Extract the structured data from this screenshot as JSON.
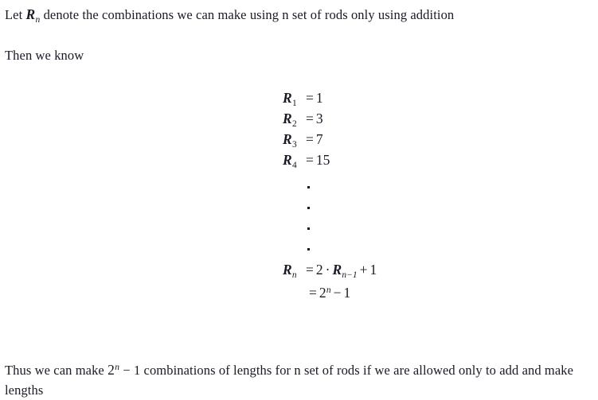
{
  "document": {
    "intro": {
      "before_var": "Let ",
      "var_base": "R",
      "var_sub": "n",
      "after_var": " denote the combinations we can make using n set of rods only using addition"
    },
    "then_line": "Then we know",
    "equations": [
      {
        "lhs_base": "R",
        "lhs_sub": "1",
        "relation": "=",
        "rhs": "1"
      },
      {
        "lhs_base": "R",
        "lhs_sub": "2",
        "relation": "=",
        "rhs": "3"
      },
      {
        "lhs_base": "R",
        "lhs_sub": "3",
        "relation": "=",
        "rhs": "7"
      },
      {
        "lhs_base": "R",
        "lhs_sub": "4",
        "relation": "=",
        "rhs": "15"
      }
    ],
    "vertical_dots_count": 4,
    "recurrence": {
      "lhs_base": "R",
      "lhs_sub": "n",
      "relation": "=",
      "rhs_coefficient": "2",
      "rhs_dot_operator": "·",
      "rhs_term_base": "R",
      "rhs_term_sub": "n−1",
      "rhs_plus": "+",
      "rhs_constant": "1"
    },
    "closed_form": {
      "relation": "=",
      "base": "2",
      "exponent": "n",
      "minus": "−",
      "constant": "1"
    },
    "conclusion": {
      "before_pow": "Thus we can make ",
      "pow_base": "2",
      "pow_exp": "n",
      "after_pow": " − 1 combinations of lengths for n set of rods if we are allowed only to add and make lengths"
    }
  },
  "colors": {
    "text": "#1a1a26",
    "background": "#ffffff"
  }
}
